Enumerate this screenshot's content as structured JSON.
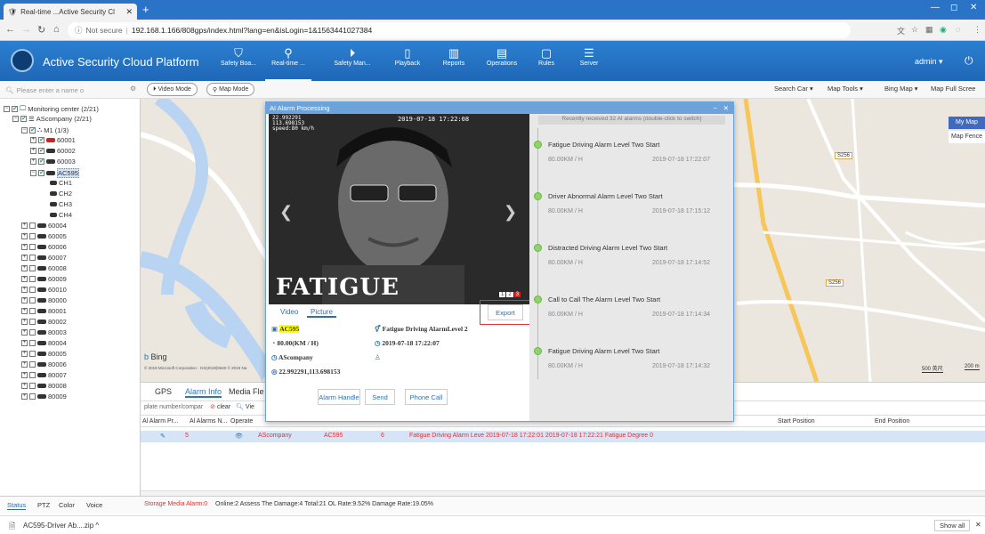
{
  "browser": {
    "tab_title": "Real-time ...Active Security Cl",
    "url_prefix": "Not secure",
    "url": "192.168.1.166/808gps/index.html?lang=en&isLogin=1&1563441027384"
  },
  "app": {
    "title": "Active Security Cloud Platform",
    "nav": [
      {
        "label": "Safety Boa...",
        "icon": "shield-icon"
      },
      {
        "label": "Real-time ...",
        "icon": "location-icon"
      },
      {
        "label": "Safety Man...",
        "icon": "play-circle-icon"
      },
      {
        "label": "Playback",
        "icon": "playback-icon"
      },
      {
        "label": "Reports",
        "icon": "reports-icon"
      },
      {
        "label": "Operations",
        "icon": "operations-icon"
      },
      {
        "label": "Rules",
        "icon": "rules-icon"
      },
      {
        "label": "Server",
        "icon": "server-icon"
      }
    ],
    "user": "admin"
  },
  "toolbar": {
    "search_placeholder": "Please enter a name o",
    "video_mode": "Video Mode",
    "map_mode": "Map Mode",
    "search_car": "Search Car",
    "map_tools": "Map Tools",
    "bing_map": "Bing Map",
    "map_fullscreen": "Map Full Scree"
  },
  "tree": {
    "root": "Monitoring center (2/21)",
    "company": "AScompany (2/21)",
    "group": "M1 (1/3)",
    "vehicles_group": [
      "60001",
      "60002",
      "60003"
    ],
    "selected": "AC595",
    "channels": [
      "CH1",
      "CH2",
      "CH3",
      "CH4"
    ],
    "vehicles": [
      "60004",
      "60005",
      "60006",
      "60007",
      "60008",
      "60009",
      "60010",
      "80000",
      "80001",
      "80002",
      "80003",
      "80004",
      "80005",
      "80006",
      "80007",
      "80008",
      "80009"
    ]
  },
  "map": {
    "my_map": "My Map",
    "map_fence": "Map Fence",
    "bing": "Bing",
    "copyright": "© 2019 Microsoft Corporation - GS(2018)5620 © 2019 Na",
    "road_labels": [
      "S256",
      "S256"
    ],
    "scale_left": "500 英尺",
    "scale_right": "200 m"
  },
  "bottom": {
    "tabs": [
      "GPS",
      "Alarm Info",
      "Media Fle"
    ],
    "filter_placeholder": "plate number/compar",
    "clear": "clear",
    "view": "Vie",
    "columns": [
      "Al Alarm Pr...",
      "Al Alarms N...",
      "Operate"
    ],
    "right_columns": [
      "Start Position",
      "End Position"
    ],
    "row": {
      "num": "5",
      "company": "AScompany",
      "device": "AC595",
      "count": "6",
      "detail": "Fatigue Driving Alarm Leve 2019-07-18 17:22:01 2019-07-18 17:22:21 Fatigue Degree 0"
    }
  },
  "status": {
    "left_tabs": [
      "Status",
      "PTZ",
      "Color",
      "Voice"
    ],
    "text_red": "Storage Media Alarm:0",
    "text": "Online:2  Assess The Damage:4  Total:21  OL Rate:9.52%  Damage Rate:19.05%"
  },
  "download": {
    "file": "AC595-Driver Ab....zip",
    "show_all": "Show all"
  },
  "dialog": {
    "title": "AI Alarm Processing",
    "overlay_line1": "22.992291",
    "overlay_line2": "113.698153",
    "overlay_line3": "speed:80 km/h",
    "overlay_time": "2019-07-18 17:22:08",
    "fatigue_text": "FATIGUE",
    "pages": [
      "1",
      "2",
      "3"
    ],
    "tab_video": "Video",
    "tab_picture": "Picture",
    "export": "Export",
    "device": "AC595",
    "speed": "80.00(KM / H)",
    "company": "AScompany",
    "coords": "22.992291,113.698153",
    "alarm_type": "Fatigue Driving AlarmLevel 2",
    "time": "2019-07-18 17:22:07",
    "buttons": [
      "Alarm Handle",
      "Send",
      "Phone Call"
    ],
    "recent": "Recently received 32 AI alarms (double-click to switch)",
    "alarms": [
      {
        "name": "Fatigue Driving Alarm Level Two Start",
        "speed": "80.00KM / H",
        "time": "2019-07-18 17:22:07"
      },
      {
        "name": "Driver Abnormal Alarm Level Two Start",
        "speed": "80.00KM / H",
        "time": "2019-07-18 17:15:12"
      },
      {
        "name": "Distracted Driving Alarm Level Two Start",
        "speed": "80.00KM / H",
        "time": "2019-07-18 17:14:52"
      },
      {
        "name": "Call to Call The Alarm Level Two Start",
        "speed": "80.00KM / H",
        "time": "2019-07-18 17:14:34"
      },
      {
        "name": "Fatigue Driving Alarm Level Two Start",
        "speed": "80.00KM / H",
        "time": "2019-07-18 17:14:32"
      }
    ]
  }
}
